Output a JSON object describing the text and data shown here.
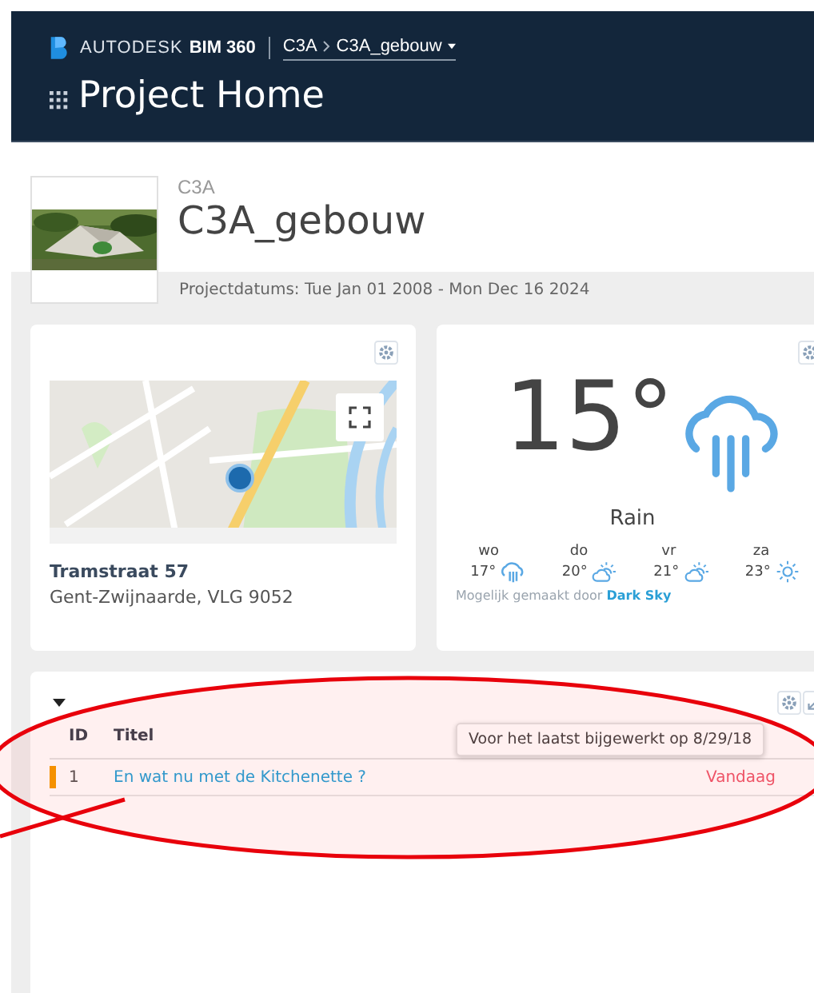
{
  "header": {
    "brand": "AUTODESK",
    "product": "BIM 360",
    "breadcrumb": [
      "C3A",
      "C3A_gebouw"
    ],
    "page_title": "Project Home"
  },
  "project": {
    "parent": "C3A",
    "name": "C3A_gebouw",
    "dates": "Projectdatums: Tue Jan 01 2008 - Mon Dec 16 2024"
  },
  "location": {
    "street": "Tramstraat 57",
    "city": "Gent-Zwijnaarde, VLG 9052"
  },
  "weather": {
    "temperature": "15°",
    "condition": "Rain",
    "kind": "rain",
    "credit": "Mogelijk gemaakt door",
    "credit_link": "Dark Sky",
    "forecast": [
      {
        "day": "wo",
        "temp": "17°",
        "kind": "rain"
      },
      {
        "day": "do",
        "temp": "20°",
        "kind": "partly-cloudy"
      },
      {
        "day": "vr",
        "temp": "21°",
        "kind": "partly-cloudy"
      },
      {
        "day": "za",
        "temp": "23°",
        "kind": "sun"
      }
    ]
  },
  "issues": {
    "columns": [
      "ID",
      "Titel"
    ],
    "tooltip": "Voor het laatst bijgewerkt op 8/29/18",
    "rows": [
      {
        "id": "1",
        "title": "En wat nu met de Kitchenette ?",
        "due": "Vandaag",
        "color": "#f59b00"
      }
    ]
  }
}
